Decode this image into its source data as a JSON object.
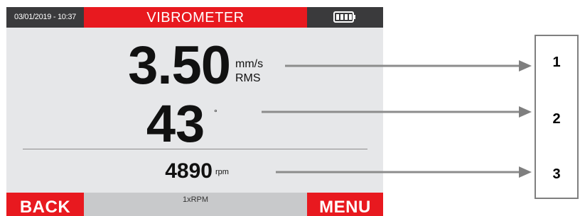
{
  "statusbar": {
    "datetime": "03/01/2019 - 10:37",
    "title": "VIBROMETER",
    "battery_icon": "battery-full-icon"
  },
  "main": {
    "vibration_value": "3.50",
    "vibration_unit": "mm/s",
    "vibration_mode": "RMS",
    "phase_value": "43",
    "phase_unit": "°",
    "speed_value": "4890",
    "speed_unit": "rpm"
  },
  "footer": {
    "back_label": "BACK",
    "mode_label": "1xRPM",
    "menu_label": "MENU"
  },
  "callouts": {
    "labels": [
      "1",
      "2",
      "3"
    ]
  },
  "colors": {
    "accent_red": "#e8191f",
    "dark_bar": "#3a3a3c",
    "screen_bg": "#e6e7e9",
    "arrow_gray": "#8c8c8c"
  }
}
